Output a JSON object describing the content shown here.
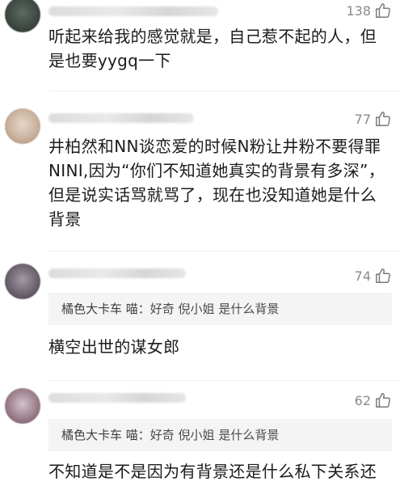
{
  "comments": [
    {
      "likes": "138",
      "text": "听起来给我的感觉就是，自己惹不起的人，但是也要yygq一下"
    },
    {
      "likes": "77",
      "text": "井柏然和NN谈恋爱的时候N粉让井粉不要得罪NINI,因为“你们不知道她真实的背景有多深”，但是说实话骂就骂了，现在也没知道她是什么背景"
    },
    {
      "likes": "74",
      "reply_name": "橘色大卡车 喵：",
      "reply_text": "好奇 倪小姐 是什么背景",
      "text": "横空出世的谋女郎"
    },
    {
      "likes": "62",
      "reply_name": "橘色大卡车 喵：",
      "reply_text": "好奇 倪小姐 是什么背景",
      "text": "不知道是不是因为有背景还是什么私下关系还"
    }
  ],
  "icons": {
    "like": "thumbs-up-outline"
  },
  "colors": {
    "text": "#1b1b1b",
    "muted": "#8a8a8a",
    "reply_bg": "#f4f4f4"
  }
}
